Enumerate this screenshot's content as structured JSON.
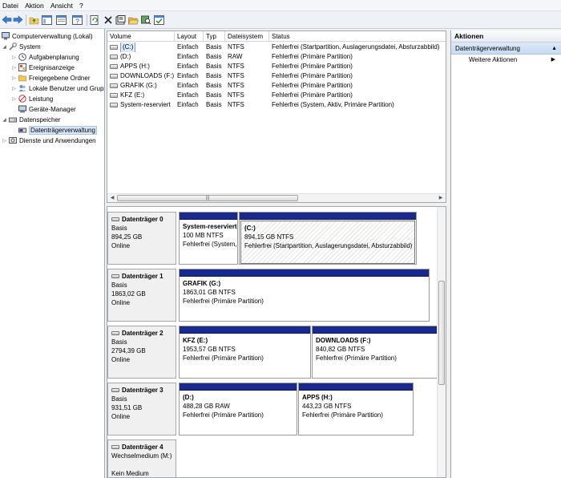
{
  "menu": [
    "Datei",
    "Aktion",
    "Ansicht",
    "?"
  ],
  "tree": [
    {
      "label": "Computerverwaltung (Lokal)",
      "icon": "computer-icon",
      "level": 0,
      "arrow": "",
      "selected": false
    },
    {
      "label": "System",
      "icon": "tools-icon",
      "level": 1,
      "arrow": "expanded",
      "selected": false
    },
    {
      "label": "Aufgabenplanung",
      "icon": "clock-icon",
      "level": 2,
      "arrow": "collapsed",
      "selected": false
    },
    {
      "label": "Ereignisanzeige",
      "icon": "event-viewer-icon",
      "level": 2,
      "arrow": "collapsed",
      "selected": false
    },
    {
      "label": "Freigegebene Ordner",
      "icon": "shared-folder-icon",
      "level": 2,
      "arrow": "collapsed",
      "selected": false
    },
    {
      "label": "Lokale Benutzer und Gruppen",
      "icon": "users-icon",
      "level": 2,
      "arrow": "collapsed",
      "selected": false
    },
    {
      "label": "Leistung",
      "icon": "performance-icon",
      "level": 2,
      "arrow": "collapsed",
      "selected": false
    },
    {
      "label": "Geräte-Manager",
      "icon": "device-manager-icon",
      "level": 2,
      "arrow": "",
      "selected": false
    },
    {
      "label": "Datenspeicher",
      "icon": "storage-icon",
      "level": 1,
      "arrow": "expanded",
      "selected": false
    },
    {
      "label": "Datenträgerverwaltung",
      "icon": "disk-management-icon",
      "level": 2,
      "arrow": "",
      "selected": true
    },
    {
      "label": "Dienste und Anwendungen",
      "icon": "services-icon",
      "level": 1,
      "arrow": "collapsed",
      "selected": false
    }
  ],
  "volume_columns": [
    "Volume",
    "Layout",
    "Typ",
    "Dateisystem",
    "Status"
  ],
  "volumes": [
    {
      "volume": "(C:)",
      "layout": "Einfach",
      "typ": "Basis",
      "fs": "NTFS",
      "status": "Fehlerfrei (Startpartition, Auslagerungsdatei, Absturzabbild)",
      "selected": true
    },
    {
      "volume": "(D:)",
      "layout": "Einfach",
      "typ": "Basis",
      "fs": "RAW",
      "status": "Fehlerfrei (Primäre Partition)",
      "selected": false
    },
    {
      "volume": "APPS (H:)",
      "layout": "Einfach",
      "typ": "Basis",
      "fs": "NTFS",
      "status": "Fehlerfrei (Primäre Partition)",
      "selected": false
    },
    {
      "volume": "DOWNLOADS (F:)",
      "layout": "Einfach",
      "typ": "Basis",
      "fs": "NTFS",
      "status": "Fehlerfrei (Primäre Partition)",
      "selected": false
    },
    {
      "volume": "GRAFIK (G:)",
      "layout": "Einfach",
      "typ": "Basis",
      "fs": "NTFS",
      "status": "Fehlerfrei (Primäre Partition)",
      "selected": false
    },
    {
      "volume": "KFZ (E:)",
      "layout": "Einfach",
      "typ": "Basis",
      "fs": "NTFS",
      "status": "Fehlerfrei (Primäre Partition)",
      "selected": false
    },
    {
      "volume": "System-reserviert",
      "layout": "Einfach",
      "typ": "Basis",
      "fs": "NTFS",
      "status": "Fehlerfrei (System, Aktiv, Primäre Partition)",
      "selected": false
    }
  ],
  "disks": [
    {
      "name": "Datenträger 0",
      "type": "Basis",
      "size": "894,25 GB",
      "state": "Online",
      "partitions": [
        {
          "name": "System-reserviert",
          "size": "100 MB NTFS",
          "status": "Fehlerfrei (System, Aktiv, Primäre Partition)",
          "hatched": false
        },
        {
          "name": "(C:)",
          "size": "894,15 GB NTFS",
          "status": "Fehlerfrei (Startpartition, Auslagerungsdatei, Absturzabbild)",
          "hatched": true
        }
      ]
    },
    {
      "name": "Datenträger 1",
      "type": "Basis",
      "size": "1863,02 GB",
      "state": "Online",
      "partitions": [
        {
          "name": "GRAFIK  (G:)",
          "size": "1863,01 GB NTFS",
          "status": "Fehlerfrei (Primäre Partition)",
          "hatched": false
        }
      ]
    },
    {
      "name": "Datenträger 2",
      "type": "Basis",
      "size": "2794,39 GB",
      "state": "Online",
      "partitions": [
        {
          "name": "KFZ  (E:)",
          "size": "1953,57 GB NTFS",
          "status": "Fehlerfrei (Primäre Partition)",
          "hatched": false
        },
        {
          "name": "DOWNLOADS  (F:)",
          "size": "840,82 GB NTFS",
          "status": "Fehlerfrei (Primäre Partition)",
          "hatched": false
        }
      ]
    },
    {
      "name": "Datenträger 3",
      "type": "Basis",
      "size": "931,51 GB",
      "state": "Online",
      "partitions": [
        {
          "name": "(D:)",
          "size": "488,28 GB RAW",
          "status": "Fehlerfrei (Primäre Partition)",
          "hatched": false
        },
        {
          "name": "APPS  (H:)",
          "size": "443,23 GB NTFS",
          "status": "Fehlerfrei (Primäre Partition)",
          "hatched": false
        }
      ]
    },
    {
      "name": "Datenträger 4",
      "type": "Wechselmedium (M:)",
      "size": "",
      "state": "Kein Medium",
      "partitions": []
    }
  ],
  "actions": {
    "title": "Aktionen",
    "section": "Datenträgerverwaltung",
    "items": [
      "Weitere Aktionen"
    ]
  },
  "colors": {
    "partition_bar": "#1a2a8c",
    "selection": "#d9e6f6"
  }
}
